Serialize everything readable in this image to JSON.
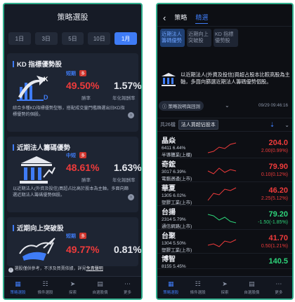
{
  "left": {
    "title": "策略選股",
    "periods": [
      "1日",
      "3日",
      "5日",
      "10日",
      "1月"
    ],
    "active_period": "1月",
    "cards": [
      {
        "title": "KD 指標優勢股",
        "term": "短期",
        "tag": "多",
        "win": "49.50%",
        "win_label": "勝率",
        "ret": "1.57%",
        "ret_label": "年化報酬率",
        "desc": "綜合多種KD指標優勢型態，搭配成交量門檻篩選出日KD指標優勢的個股。",
        "illustration": "chart-arrow-kd-icon"
      },
      {
        "title": "近期法人籌碼優勢",
        "term": "中短",
        "tag": "多",
        "win": "48.61%",
        "win_label": "勝率",
        "ret": "1.63%",
        "ret_label": "年化報酬率",
        "desc": "以近期法人(外資及投信)買超占比高於股本為主軸，多面向篩選近期法人籌碼優勢個股。",
        "illustration": "bank-icon"
      },
      {
        "title": "近期向上突破股",
        "term": "短期",
        "tag": "多",
        "win": "49.77%",
        "win_label": "勝率",
        "ret": "0.81%",
        "ret_label": "年化報酬率",
        "desc": "",
        "illustration": "bull-icon"
      }
    ],
    "notice": {
      "text": "選股僅供參考，不涉及買賣依據，詳見",
      "link": "免責聲明"
    },
    "nav": [
      {
        "label": "策略選股",
        "icon": "strategy-icon",
        "on": true
      },
      {
        "label": "條件選股",
        "icon": "filter-icon",
        "on": false
      },
      {
        "label": "探索",
        "icon": "explore-icon",
        "on": false
      },
      {
        "label": "自選股價",
        "icon": "watchlist-icon",
        "on": false
      },
      {
        "label": "更多",
        "icon": "more-icon",
        "on": false
      }
    ]
  },
  "right": {
    "tabs": [
      "策略",
      "精選"
    ],
    "chips": [
      {
        "label": "近期法人籌碼優勢",
        "on": true
      },
      {
        "label": "近期向上突破股",
        "on": false
      },
      {
        "label": "KD 指標優勢股",
        "on": false
      }
    ],
    "description": "以近期法人(外資及投信)買超占股本比較高股為主軸，多面向篩選近期法人籌碼優勢個股。",
    "explain_button": "策略說明與回測",
    "timestamp": "09/29 09:46:16",
    "count": "共26檔",
    "sort_label": "法人買超佔股本",
    "rows": [
      {
        "name": "晶焱",
        "code": "6411",
        "pct": "6.44%",
        "sector": "半導體業(上櫃)",
        "price": "204.0",
        "change": "2.00(0.99%)",
        "dir": "up"
      },
      {
        "name": "奇鋐",
        "code": "3017",
        "pct": "6.39%",
        "sector": "電腦週邊(上市)",
        "price": "79.90",
        "change": "0.10(0.12%)",
        "dir": "up"
      },
      {
        "name": "華夏",
        "code": "1305",
        "pct": "6.02%",
        "sector": "塑膠工業(上市)",
        "price": "46.20",
        "change": "2.25(5.12%)",
        "dir": "up"
      },
      {
        "name": "台揚",
        "code": "2314",
        "pct": "5.79%",
        "sector": "通信網路(上市)",
        "price": "79.20",
        "change": "-1.50(-1.85%)",
        "dir": "dn"
      },
      {
        "name": "台聚",
        "code": "1304",
        "pct": "5.50%",
        "sector": "塑膠工業(上市)",
        "price": "41.70",
        "change": "0.50(1.21%)",
        "dir": "up"
      },
      {
        "name": "博智",
        "code": "8155",
        "pct": "5.45%",
        "sector": "",
        "price": "140.5",
        "change": "",
        "dir": "dn"
      }
    ],
    "nav": [
      {
        "label": "策略選股",
        "icon": "strategy-icon",
        "on": true
      },
      {
        "label": "條件選股",
        "icon": "filter-icon",
        "on": false
      },
      {
        "label": "探索",
        "icon": "explore-icon",
        "on": false
      },
      {
        "label": "自選股價",
        "icon": "watchlist-icon",
        "on": false
      },
      {
        "label": "更多",
        "icon": "more-icon",
        "on": false
      }
    ],
    "colors": {
      "up": "#ef3b3b",
      "down": "#2ed47a",
      "accent": "#3f7cf6"
    }
  }
}
